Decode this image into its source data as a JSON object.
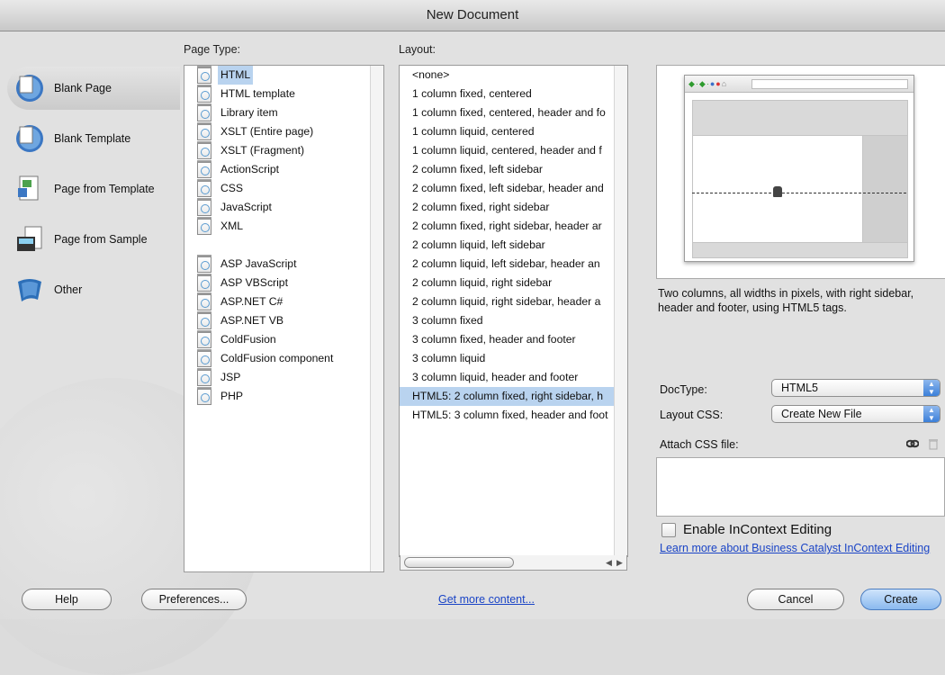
{
  "window": {
    "title": "New Document"
  },
  "labels": {
    "page_type": "Page Type:",
    "layout": "Layout:"
  },
  "categories": [
    {
      "label": "Blank Page",
      "selected": true,
      "icon": "blank-page-icon"
    },
    {
      "label": "Blank Template",
      "selected": false,
      "icon": "blank-template-icon"
    },
    {
      "label": "Page from Template",
      "selected": false,
      "icon": "page-from-template-icon"
    },
    {
      "label": "Page from Sample",
      "selected": false,
      "icon": "page-from-sample-icon"
    },
    {
      "label": "Other",
      "selected": false,
      "icon": "other-icon"
    }
  ],
  "page_types": [
    "HTML",
    "HTML template",
    "Library item",
    "XSLT (Entire page)",
    "XSLT (Fragment)",
    "ActionScript",
    "CSS",
    "JavaScript",
    "XML",
    "",
    "ASP JavaScript",
    "ASP VBScript",
    "ASP.NET C#",
    "ASP.NET VB",
    "ColdFusion",
    "ColdFusion component",
    "JSP",
    "PHP"
  ],
  "page_type_selected": 0,
  "layouts": [
    "<none>",
    "1 column fixed, centered",
    "1 column fixed, centered, header and fo",
    "1 column liquid, centered",
    "1 column liquid, centered, header and f",
    "2 column fixed, left sidebar",
    "2 column fixed, left sidebar, header and",
    "2 column fixed, right sidebar",
    "2 column fixed, right sidebar, header ar",
    "2 column liquid, left sidebar",
    "2 column liquid, left sidebar, header an",
    "2 column liquid, right sidebar",
    "2 column liquid, right sidebar, header a",
    "3 column fixed",
    "3 column fixed, header and footer",
    "3 column liquid",
    "3 column liquid, header and footer",
    "HTML5: 2 column fixed, right sidebar, h",
    "HTML5: 3 column fixed, header and foot"
  ],
  "layout_selected": 17,
  "description": "Two columns, all widths in pixels, with right sidebar, header and footer, using HTML5 tags.",
  "doctype": {
    "label": "DocType:",
    "value": "HTML5"
  },
  "layout_css": {
    "label": "Layout CSS:",
    "value": "Create New File"
  },
  "attach_css": {
    "label": "Attach CSS file:"
  },
  "incontext": {
    "label": "Enable InContext Editing",
    "checked": false
  },
  "learn_more": "Learn more about Business Catalyst InContext Editing",
  "buttons": {
    "help": "Help",
    "preferences": "Preferences...",
    "get_more": "Get more content...",
    "cancel": "Cancel",
    "create": "Create"
  },
  "colors": {
    "selection": "#b9d3ef",
    "link": "#1a44c6",
    "accent": "#3b7fd9"
  }
}
